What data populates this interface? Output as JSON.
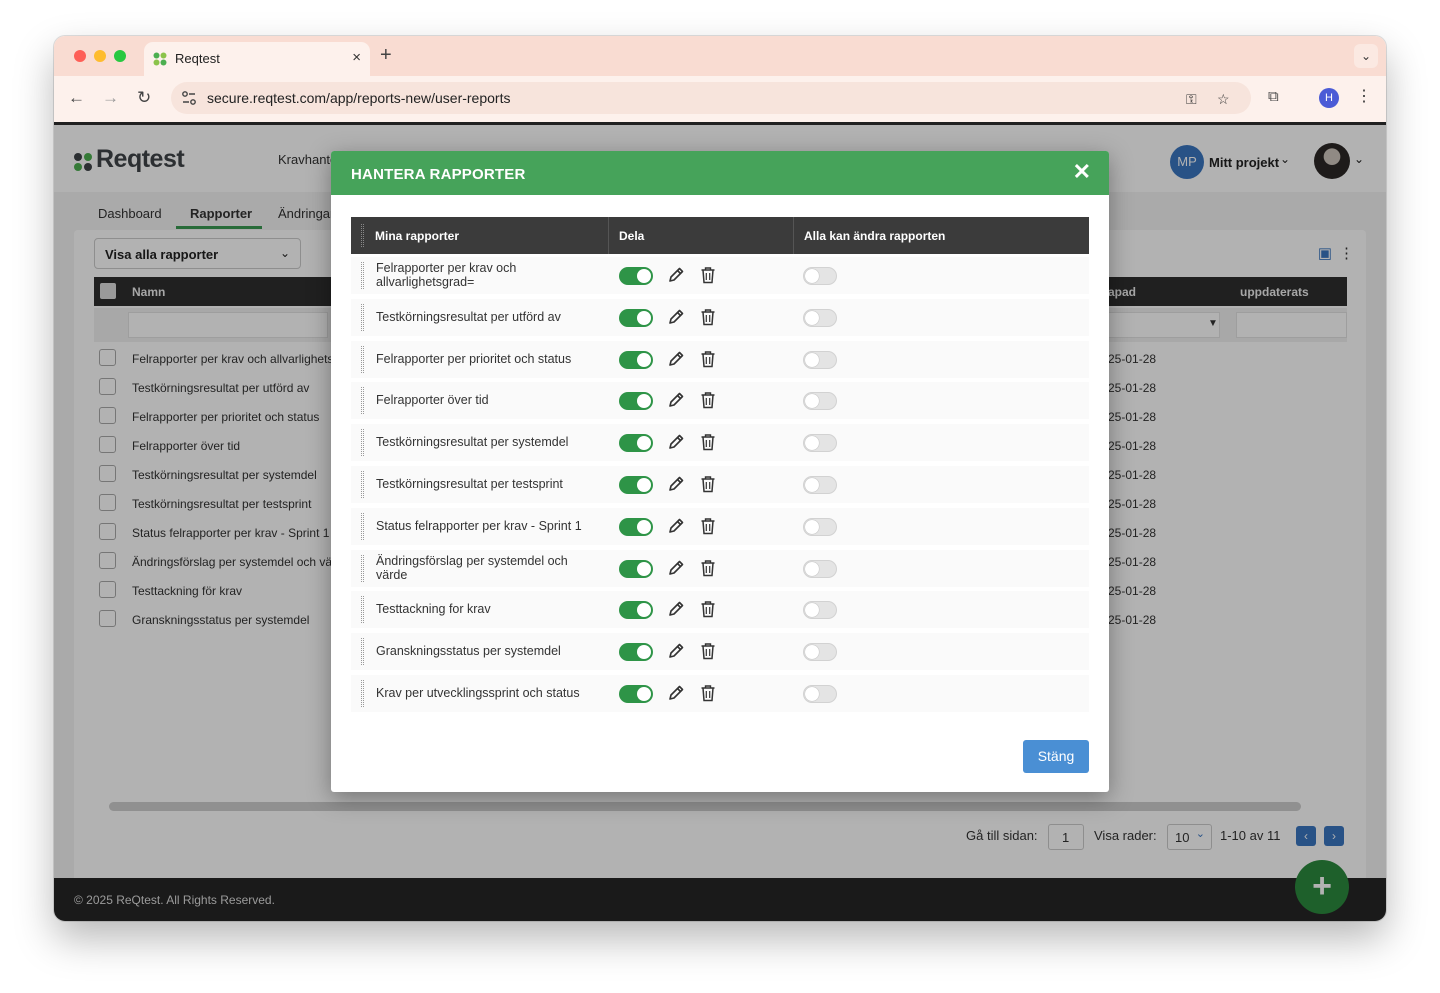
{
  "browser": {
    "tab_title": "Reqtest",
    "tab_close": "×",
    "new_tab": "+",
    "url": "secure.reqtest.com/app/reports-new/user-reports",
    "profile_initial": "H"
  },
  "app": {
    "logo_text": "Reqtest",
    "topnav_label": "Kravhante",
    "project_initials": "MP",
    "project_name": "Mitt projekt",
    "subtabs": [
      "Dashboard",
      "Rapporter",
      "Ändringar"
    ],
    "filter_label": "Visa alla rapporter",
    "grid_headers": {
      "name": "Namn",
      "created": "apad",
      "updated": "uppdaterats"
    },
    "rows": [
      {
        "name": "Felrapporter per krav och allvarlighetsg",
        "date": "25-01-28"
      },
      {
        "name": "Testkörningsresultat per utförd av",
        "date": "25-01-28"
      },
      {
        "name": "Felrapporter per prioritet och status",
        "date": "25-01-28"
      },
      {
        "name": "Felrapporter över tid",
        "date": "25-01-28"
      },
      {
        "name": "Testkörningsresultat per systemdel",
        "date": "25-01-28"
      },
      {
        "name": "Testkörningsresultat per testsprint",
        "date": "25-01-28"
      },
      {
        "name": "Status felrapporter per krav - Sprint 1",
        "date": "25-01-28"
      },
      {
        "name": "Ändringsförslag per systemdel och vär",
        "date": "25-01-28"
      },
      {
        "name": "Testtackning för krav",
        "date": "25-01-28"
      },
      {
        "name": "Granskningsstatus per systemdel",
        "date": "25-01-28"
      }
    ],
    "pager": {
      "goto_label": "Gå till sidan:",
      "goto_value": "1",
      "rows_label": "Visa rader:",
      "rows_value": "10",
      "range": "1-10 av 11"
    },
    "footer": "© 2025 ReQtest. All Rights Reserved.",
    "fab_label": "+"
  },
  "modal": {
    "title": "HANTERA RAPPORTER",
    "close_glyph": "✕",
    "headers": {
      "reports": "Mina rapporter",
      "share": "Dela",
      "all_can_edit": "Alla kan ändra rapporten"
    },
    "rows": [
      {
        "name": "Felrapporter per krav och allvarlighetsgrad="
      },
      {
        "name": "Testkörningsresultat per utförd av"
      },
      {
        "name": "Felrapporter per prioritet och status"
      },
      {
        "name": "Felrapporter över tid"
      },
      {
        "name": "Testkörningsresultat per systemdel"
      },
      {
        "name": "Testkörningsresultat per testsprint"
      },
      {
        "name": "Status felrapporter per krav - Sprint 1"
      },
      {
        "name": "Ändringsförslag per systemdel och värde"
      },
      {
        "name": "Testtackning for krav"
      },
      {
        "name": "Granskningsstatus per systemdel"
      },
      {
        "name": "Krav per utvecklingssprint och status"
      }
    ],
    "close_button": "Stäng"
  },
  "colors": {
    "brand_green": "#46a35a",
    "toggle_on": "#2e9447",
    "button_blue": "#4a8fd4"
  }
}
